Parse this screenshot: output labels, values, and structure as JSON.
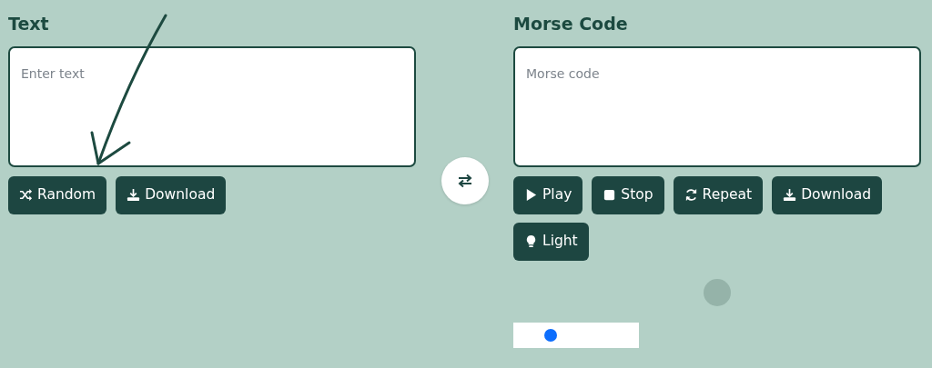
{
  "panels": [
    {
      "title": "Text",
      "placeholder": "Enter text",
      "buttons": [
        {
          "kind": "shuffle",
          "label": "Random"
        },
        {
          "kind": "download",
          "label": "Download"
        }
      ]
    },
    {
      "title": "Morse Code",
      "placeholder": "Morse code",
      "buttons": [
        {
          "kind": "play",
          "label": "Play"
        },
        {
          "kind": "stop",
          "label": "Stop"
        },
        {
          "kind": "repeat",
          "label": "Repeat"
        },
        {
          "kind": "download",
          "label": "Download"
        },
        {
          "kind": "light",
          "label": "Light"
        }
      ]
    }
  ],
  "slider": {
    "level": 0.3
  }
}
